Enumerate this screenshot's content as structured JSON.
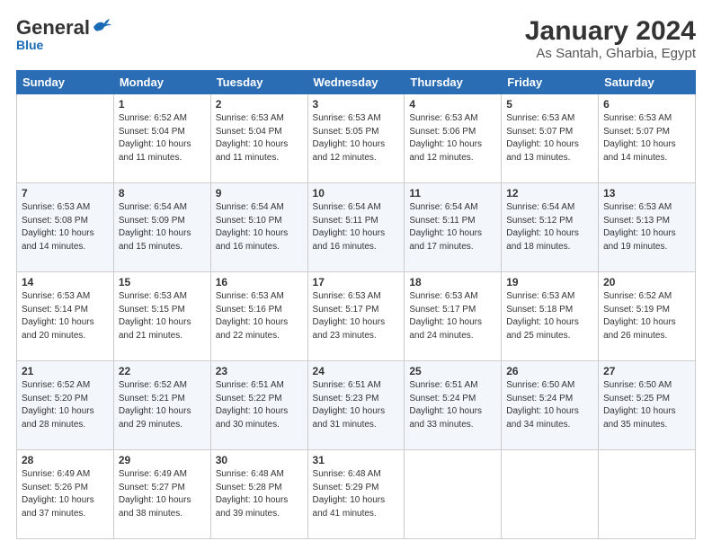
{
  "header": {
    "logo_general": "General",
    "logo_blue": "Blue",
    "title": "January 2024",
    "subtitle": "As Santah, Gharbia, Egypt"
  },
  "days_of_week": [
    "Sunday",
    "Monday",
    "Tuesday",
    "Wednesday",
    "Thursday",
    "Friday",
    "Saturday"
  ],
  "weeks": [
    [
      {
        "day": "",
        "info": ""
      },
      {
        "day": "1",
        "info": "Sunrise: 6:52 AM\nSunset: 5:04 PM\nDaylight: 10 hours\nand 11 minutes."
      },
      {
        "day": "2",
        "info": "Sunrise: 6:53 AM\nSunset: 5:04 PM\nDaylight: 10 hours\nand 11 minutes."
      },
      {
        "day": "3",
        "info": "Sunrise: 6:53 AM\nSunset: 5:05 PM\nDaylight: 10 hours\nand 12 minutes."
      },
      {
        "day": "4",
        "info": "Sunrise: 6:53 AM\nSunset: 5:06 PM\nDaylight: 10 hours\nand 12 minutes."
      },
      {
        "day": "5",
        "info": "Sunrise: 6:53 AM\nSunset: 5:07 PM\nDaylight: 10 hours\nand 13 minutes."
      },
      {
        "day": "6",
        "info": "Sunrise: 6:53 AM\nSunset: 5:07 PM\nDaylight: 10 hours\nand 14 minutes."
      }
    ],
    [
      {
        "day": "7",
        "info": "Sunrise: 6:53 AM\nSunset: 5:08 PM\nDaylight: 10 hours\nand 14 minutes."
      },
      {
        "day": "8",
        "info": "Sunrise: 6:54 AM\nSunset: 5:09 PM\nDaylight: 10 hours\nand 15 minutes."
      },
      {
        "day": "9",
        "info": "Sunrise: 6:54 AM\nSunset: 5:10 PM\nDaylight: 10 hours\nand 16 minutes."
      },
      {
        "day": "10",
        "info": "Sunrise: 6:54 AM\nSunset: 5:11 PM\nDaylight: 10 hours\nand 16 minutes."
      },
      {
        "day": "11",
        "info": "Sunrise: 6:54 AM\nSunset: 5:11 PM\nDaylight: 10 hours\nand 17 minutes."
      },
      {
        "day": "12",
        "info": "Sunrise: 6:54 AM\nSunset: 5:12 PM\nDaylight: 10 hours\nand 18 minutes."
      },
      {
        "day": "13",
        "info": "Sunrise: 6:53 AM\nSunset: 5:13 PM\nDaylight: 10 hours\nand 19 minutes."
      }
    ],
    [
      {
        "day": "14",
        "info": "Sunrise: 6:53 AM\nSunset: 5:14 PM\nDaylight: 10 hours\nand 20 minutes."
      },
      {
        "day": "15",
        "info": "Sunrise: 6:53 AM\nSunset: 5:15 PM\nDaylight: 10 hours\nand 21 minutes."
      },
      {
        "day": "16",
        "info": "Sunrise: 6:53 AM\nSunset: 5:16 PM\nDaylight: 10 hours\nand 22 minutes."
      },
      {
        "day": "17",
        "info": "Sunrise: 6:53 AM\nSunset: 5:17 PM\nDaylight: 10 hours\nand 23 minutes."
      },
      {
        "day": "18",
        "info": "Sunrise: 6:53 AM\nSunset: 5:17 PM\nDaylight: 10 hours\nand 24 minutes."
      },
      {
        "day": "19",
        "info": "Sunrise: 6:53 AM\nSunset: 5:18 PM\nDaylight: 10 hours\nand 25 minutes."
      },
      {
        "day": "20",
        "info": "Sunrise: 6:52 AM\nSunset: 5:19 PM\nDaylight: 10 hours\nand 26 minutes."
      }
    ],
    [
      {
        "day": "21",
        "info": "Sunrise: 6:52 AM\nSunset: 5:20 PM\nDaylight: 10 hours\nand 28 minutes."
      },
      {
        "day": "22",
        "info": "Sunrise: 6:52 AM\nSunset: 5:21 PM\nDaylight: 10 hours\nand 29 minutes."
      },
      {
        "day": "23",
        "info": "Sunrise: 6:51 AM\nSunset: 5:22 PM\nDaylight: 10 hours\nand 30 minutes."
      },
      {
        "day": "24",
        "info": "Sunrise: 6:51 AM\nSunset: 5:23 PM\nDaylight: 10 hours\nand 31 minutes."
      },
      {
        "day": "25",
        "info": "Sunrise: 6:51 AM\nSunset: 5:24 PM\nDaylight: 10 hours\nand 33 minutes."
      },
      {
        "day": "26",
        "info": "Sunrise: 6:50 AM\nSunset: 5:24 PM\nDaylight: 10 hours\nand 34 minutes."
      },
      {
        "day": "27",
        "info": "Sunrise: 6:50 AM\nSunset: 5:25 PM\nDaylight: 10 hours\nand 35 minutes."
      }
    ],
    [
      {
        "day": "28",
        "info": "Sunrise: 6:49 AM\nSunset: 5:26 PM\nDaylight: 10 hours\nand 37 minutes."
      },
      {
        "day": "29",
        "info": "Sunrise: 6:49 AM\nSunset: 5:27 PM\nDaylight: 10 hours\nand 38 minutes."
      },
      {
        "day": "30",
        "info": "Sunrise: 6:48 AM\nSunset: 5:28 PM\nDaylight: 10 hours\nand 39 minutes."
      },
      {
        "day": "31",
        "info": "Sunrise: 6:48 AM\nSunset: 5:29 PM\nDaylight: 10 hours\nand 41 minutes."
      },
      {
        "day": "",
        "info": ""
      },
      {
        "day": "",
        "info": ""
      },
      {
        "day": "",
        "info": ""
      }
    ]
  ]
}
